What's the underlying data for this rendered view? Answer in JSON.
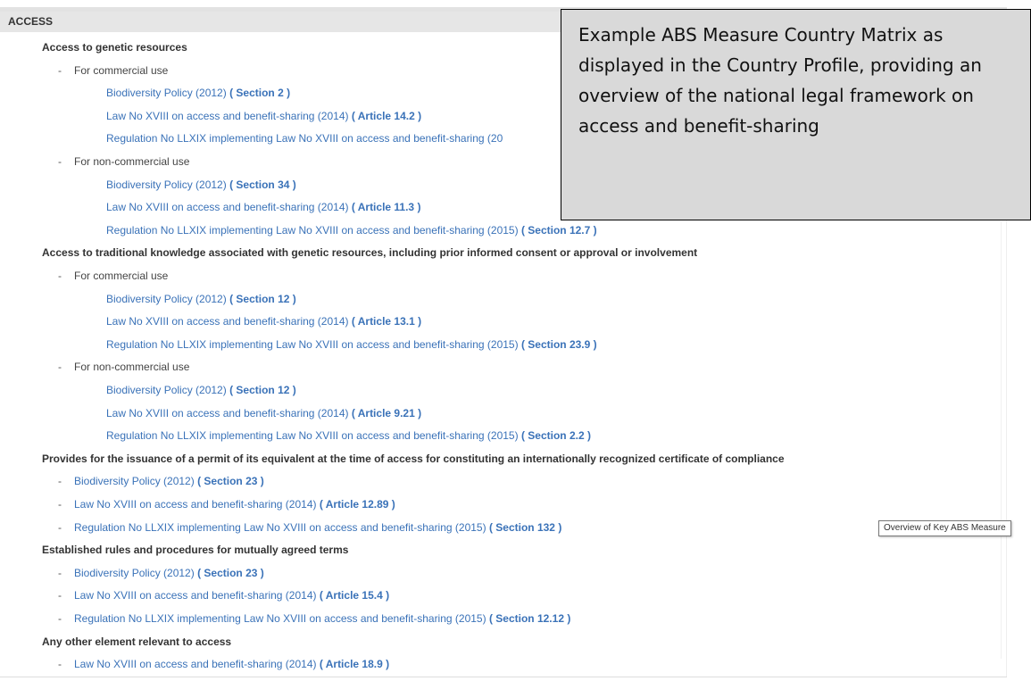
{
  "section_header": "ACCESS",
  "rows": [
    {
      "kind": "cat",
      "text": "Access to genetic resources"
    },
    {
      "kind": "sub",
      "text": "For commercial use"
    },
    {
      "kind": "ref",
      "level": 2,
      "doc": "Biodiversity Policy (2012)",
      "ref": "( Section 2 )"
    },
    {
      "kind": "ref",
      "level": 2,
      "doc": "Law No XVIII on access and benefit-sharing (2014)",
      "ref": "( Article 14.2 )"
    },
    {
      "kind": "ref",
      "level": 2,
      "doc": "Regulation No LLXIX implementing Law No XVIII on access and benefit-sharing (20",
      "ref": ""
    },
    {
      "kind": "sub",
      "text": "For non-commercial use"
    },
    {
      "kind": "ref",
      "level": 2,
      "doc": "Biodiversity Policy (2012)",
      "ref": "( Section 34 )"
    },
    {
      "kind": "ref",
      "level": 2,
      "doc": "Law No XVIII on access and benefit-sharing (2014)",
      "ref": "( Article 11.3 )"
    },
    {
      "kind": "ref",
      "level": 2,
      "doc": "Regulation No LLXIX implementing Law No XVIII on access and benefit-sharing (2015)",
      "ref": "( Section 12.7 )"
    },
    {
      "kind": "cat",
      "text": "Access to traditional knowledge associated with genetic resources, including prior informed consent or approval or involvement"
    },
    {
      "kind": "sub",
      "text": "For commercial use"
    },
    {
      "kind": "ref",
      "level": 2,
      "doc": "Biodiversity Policy (2012)",
      "ref": "( Section 12 )"
    },
    {
      "kind": "ref",
      "level": 2,
      "doc": "Law No XVIII on access and benefit-sharing (2014)",
      "ref": "( Article 13.1 )"
    },
    {
      "kind": "ref",
      "level": 2,
      "doc": "Regulation No LLXIX implementing Law No XVIII on access and benefit-sharing (2015)",
      "ref": "( Section 23.9 )"
    },
    {
      "kind": "sub",
      "text": "For non-commercial use"
    },
    {
      "kind": "ref",
      "level": 2,
      "doc": "Biodiversity Policy (2012)",
      "ref": "( Section 12 )"
    },
    {
      "kind": "ref",
      "level": 2,
      "doc": "Law No XVIII on access and benefit-sharing (2014)",
      "ref": "( Article 9.21 )"
    },
    {
      "kind": "ref",
      "level": 2,
      "doc": "Regulation No LLXIX implementing Law No XVIII on access and benefit-sharing (2015)",
      "ref": "( Section 2.2 )"
    },
    {
      "kind": "cat",
      "text": "Provides for the issuance of a permit of its equivalent at the time of access for constituting an internationally recognized certificate of compliance"
    },
    {
      "kind": "ref",
      "level": 1,
      "doc": "Biodiversity Policy (2012)",
      "ref": "( Section 23 )"
    },
    {
      "kind": "ref",
      "level": 1,
      "doc": "Law No XVIII on access and benefit-sharing (2014)",
      "ref": "( Article 12.89 )"
    },
    {
      "kind": "ref",
      "level": 1,
      "doc": "Regulation No LLXIX implementing Law No XVIII on access and benefit-sharing (2015)",
      "ref": "( Section 132 )"
    },
    {
      "kind": "cat",
      "text": "Established rules and procedures for mutually agreed terms"
    },
    {
      "kind": "ref",
      "level": 1,
      "doc": "Biodiversity Policy (2012)",
      "ref": "( Section 23 )"
    },
    {
      "kind": "ref",
      "level": 1,
      "doc": "Law No XVIII on access and benefit-sharing (2014)",
      "ref": "( Article 15.4 )"
    },
    {
      "kind": "ref",
      "level": 1,
      "doc": "Regulation No LLXIX implementing Law No XVIII on access and benefit-sharing (2015)",
      "ref": "( Section 12.12 )"
    },
    {
      "kind": "cat",
      "text": "Any other element relevant to access"
    },
    {
      "kind": "ref",
      "level": 1,
      "doc": "Law No XVIII on access and benefit-sharing (2014)",
      "ref": "( Article 18.9 )"
    }
  ],
  "callout": {
    "text": "Example ABS Measure Country Matrix as displayed in the Country Profile, providing an overview of the national legal framework on access and benefit-sharing"
  },
  "tooltip": {
    "text": "Overview of Key ABS Measure"
  },
  "dash_glyph": "-",
  "colors": {
    "link": "#3a72b8",
    "header_bg": "#e6e6e6",
    "callout_bg": "#d9d9d9"
  }
}
